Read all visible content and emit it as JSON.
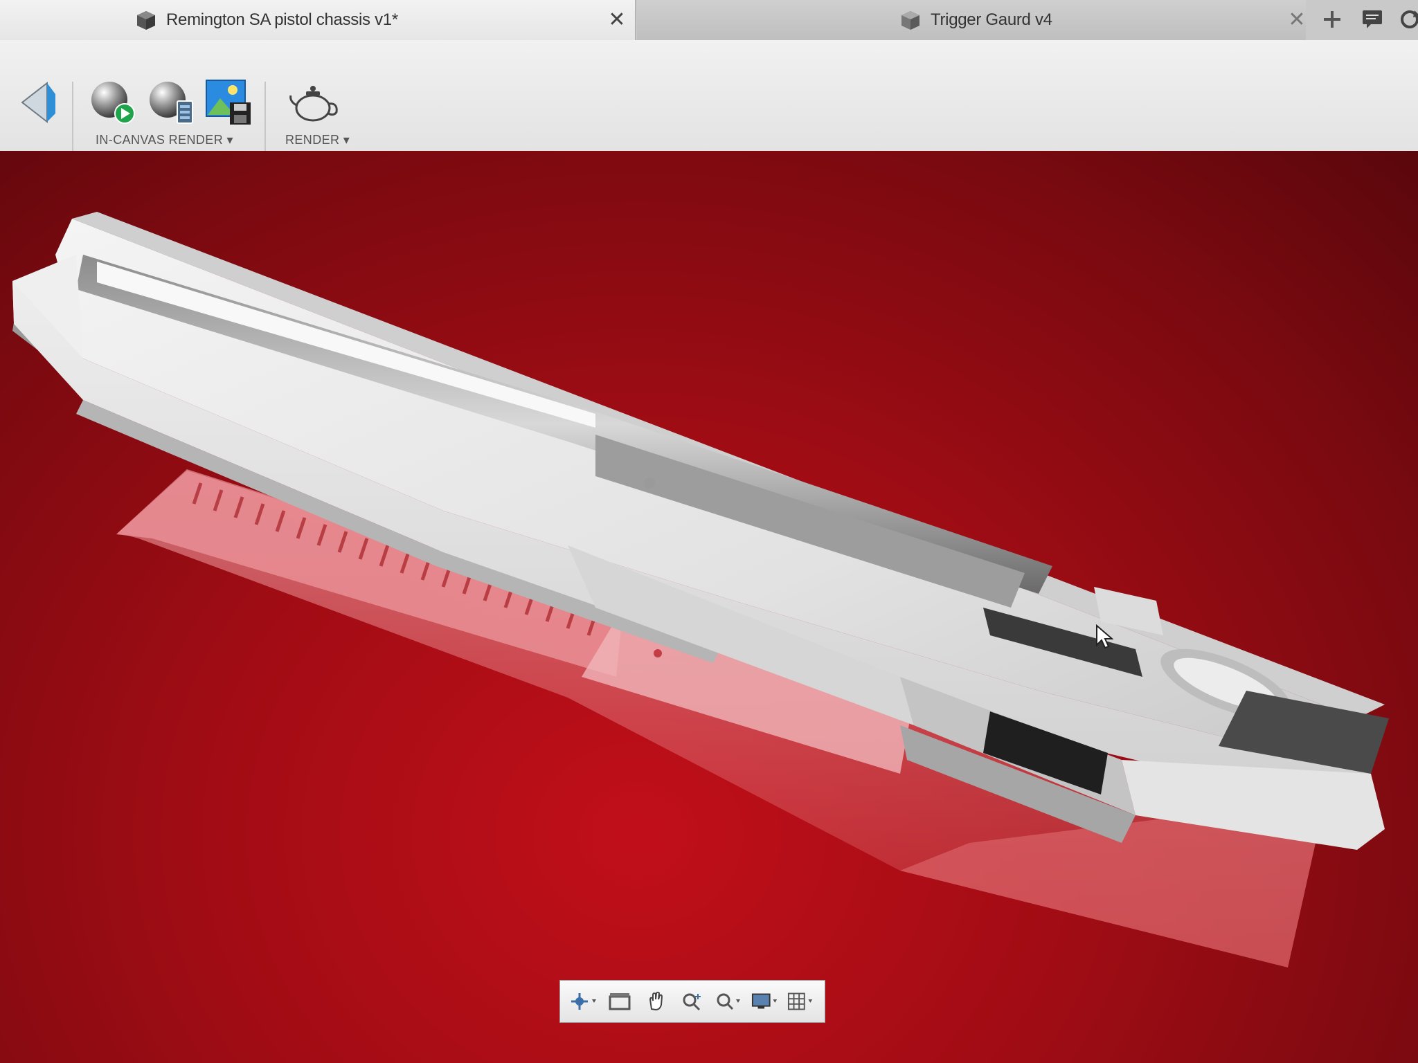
{
  "tabs": [
    {
      "label": "Remington SA pistol chassis v1*",
      "icon": "document-cube-icon",
      "active": true
    },
    {
      "label": "Trigger Gaurd v4",
      "icon": "document-cube-icon",
      "active": false
    }
  ],
  "tab_close_glyph": "✕",
  "tabbar_buttons": [
    "new-tab-icon",
    "chat-icon",
    "sync-icon"
  ],
  "toolbar": {
    "groups": [
      {
        "label": "IN-CANVAS RENDER ▾",
        "icons": [
          "start-render-icon",
          "render-settings-icon",
          "capture-image-icon"
        ]
      },
      {
        "label": "RENDER ▾",
        "icons": [
          "teapot-render-icon"
        ]
      }
    ],
    "leading_icon": "appearance-icon"
  },
  "canvas": {
    "background_color": "#a10c14",
    "model": "Remington SA pistol chassis"
  },
  "navigation_bar": [
    "orbit-icon",
    "look-at-icon",
    "pan-icon",
    "zoom-icon",
    "fit-icon",
    "display-settings-icon",
    "grid-settings-icon"
  ]
}
